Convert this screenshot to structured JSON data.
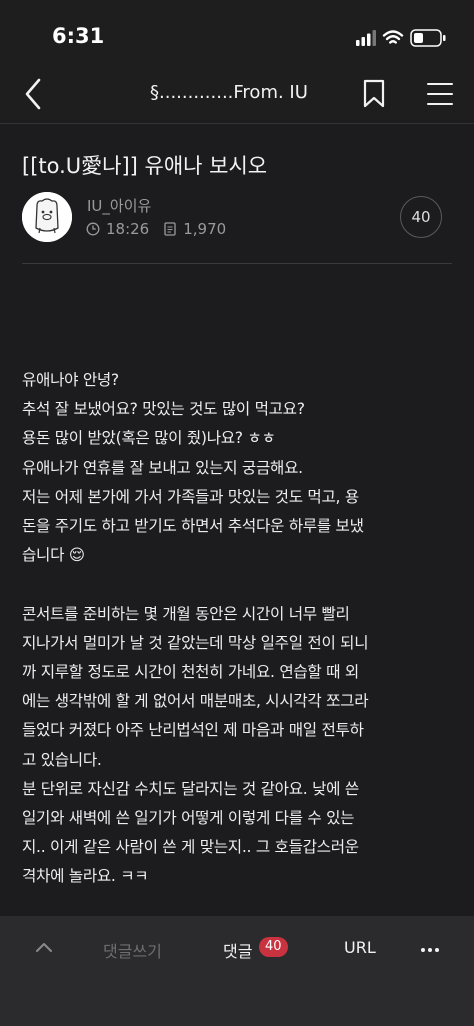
{
  "status": {
    "time": "6:31"
  },
  "nav": {
    "title": "§.............From. IU"
  },
  "post": {
    "title": "[[to.U愛나]] 유애나 보시오",
    "author": "IU_아이유",
    "time": "18:26",
    "views": "1,970",
    "comment_count": "40"
  },
  "content": {
    "lines": [
      "유애나야 안녕?",
      "추석 잘 보냈어요? 맛있는 것도 많이 먹고요?",
      "용돈 많이 받았(혹은 많이 줬)나요? ㅎㅎ",
      "유애나가 연휴를 잘 보내고 있는지 궁금해요.",
      "저는 어제 본가에 가서 가족들과 맛있는 것도 먹고, 용",
      "돈을 주기도 하고 받기도 하면서 추석다운 하루를 보냈",
      "습니다 😌",
      "",
      " 콘서트를 준비하는 몇 개월 동안은 시간이 너무 빨리",
      "지나가서 멀미가 날 것 같았는데 막상 일주일 전이 되니",
      "까 지루할 정도로 시간이 천천히 가네요. 연습할 때 외",
      "에는 생각밖에 할 게 없어서 매분매초, 시시각각 쪼그라",
      "들었다 커졌다 아주 난리법석인 제 마음과 매일 전투하",
      "고 있습니다.",
      "분 단위로 자신감 수치도 달라지는 것 같아요. 낮에 쓴",
      "일기와 새벽에 쓴 일기가 어떻게 이렇게 다를 수 있는",
      "지.. 이게 같은 사람이 쓴 게 맞는지.. 그 호들갑스러운",
      "격차에 놀라요. ㅋㅋ"
    ]
  },
  "bottom": {
    "write_label": "댓글쓰기",
    "comments_label": "댓글",
    "comments_badge": "40",
    "url_label": "URL"
  },
  "icons": [
    "back-icon",
    "bookmark-icon",
    "menu-icon",
    "clock-icon",
    "document-icon",
    "chevron-up-icon",
    "more-icon",
    "signal-icon",
    "wifi-icon",
    "battery-icon"
  ],
  "colors": {
    "background": "#1c1c1e",
    "badge": "#c8333f",
    "bottom_bar": "#2b2b2e"
  }
}
